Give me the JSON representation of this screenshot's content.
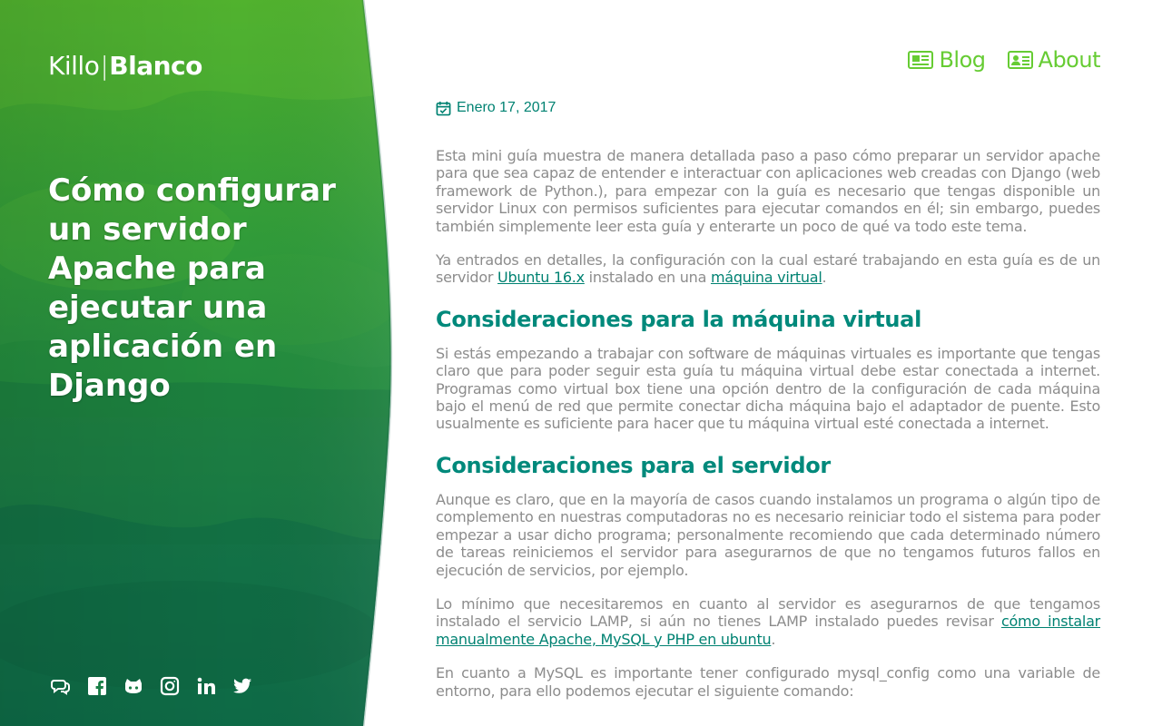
{
  "colors": {
    "accent_green": "#66cc33",
    "heading_teal": "#00897b",
    "link_teal": "#008272",
    "body_gray": "#8c8c8c",
    "hero_top": "#4caf2a",
    "hero_bottom": "#0b6e4f"
  },
  "brand": {
    "first": "Killo",
    "separator": "|",
    "second": "Blanco"
  },
  "hero": {
    "title": "Cómo configurar un servidor Apache para ejecutar una aplicación en Django"
  },
  "social": [
    {
      "name": "chat-icon"
    },
    {
      "name": "facebook-icon"
    },
    {
      "name": "github-icon"
    },
    {
      "name": "instagram-icon"
    },
    {
      "name": "linkedin-icon"
    },
    {
      "name": "twitter-icon"
    }
  ],
  "nav": {
    "blog_label": "Blog",
    "blog_icon": "newspaper-icon",
    "about_label": "About",
    "about_icon": "id-card-icon"
  },
  "article": {
    "date_icon": "calendar-check-icon",
    "date": "Enero 17, 2017",
    "p1": "Esta mini guía muestra de manera detallada paso a paso cómo preparar un servidor apache para que sea capaz de entender e interactuar con aplicaciones web creadas con Django (web framework de Python.), para empezar con la guía es necesario que tengas disponible un servidor Linux con permisos suficientes para ejecutar comandos en él; sin embargo, puedes también simplemente leer esta guía y enterarte un poco de qué va todo este tema.",
    "p2_before": "Ya entrados en detalles, la configuración con la cual estaré trabajando en esta guía es de un servidor ",
    "p2_link1": "Ubuntu 16.x",
    "p2_mid": " instalado en una ",
    "p2_link2": "máquina virtual",
    "p2_after": ".",
    "h2_vm": "Consideraciones para la máquina virtual",
    "p3": "Si estás empezando a trabajar con software de máquinas virtuales es importante que tengas claro que para poder seguir esta guía tu máquina virtual debe estar conectada a internet. Programas como virtual box tiene una opción dentro de la configuración de cada máquina bajo el menú de red que permite conectar dicha máquina bajo el adaptador de puente. Esto usualmente es suficiente para hacer que tu máquina virtual esté conectada a internet.",
    "h2_server": "Consideraciones para el servidor",
    "p4": "Aunque es claro, que en la mayoría de casos cuando instalamos un programa o algún tipo de complemento en nuestras computadoras no es necesario reiniciar todo el sistema para poder empezar a usar dicho programa; personalmente recomiendo que cada determinado número de tareas reiniciemos el servidor para asegurarnos de que no tengamos futuros fallos en ejecución de servicios, por ejemplo.",
    "p5_before": "Lo mínimo que necesitaremos en cuanto al servidor es asegurarnos de que tengamos instalado el servicio LAMP, si aún no tienes LAMP instalado puedes revisar ",
    "p5_link": "cómo instalar manualmente Apache, MySQL y PHP en ubuntu",
    "p5_after": ".",
    "p6": "En cuanto a MySQL es importante tener configurado mysql_config como una variable de entorno, para ello podemos ejecutar el siguiente comando:"
  }
}
